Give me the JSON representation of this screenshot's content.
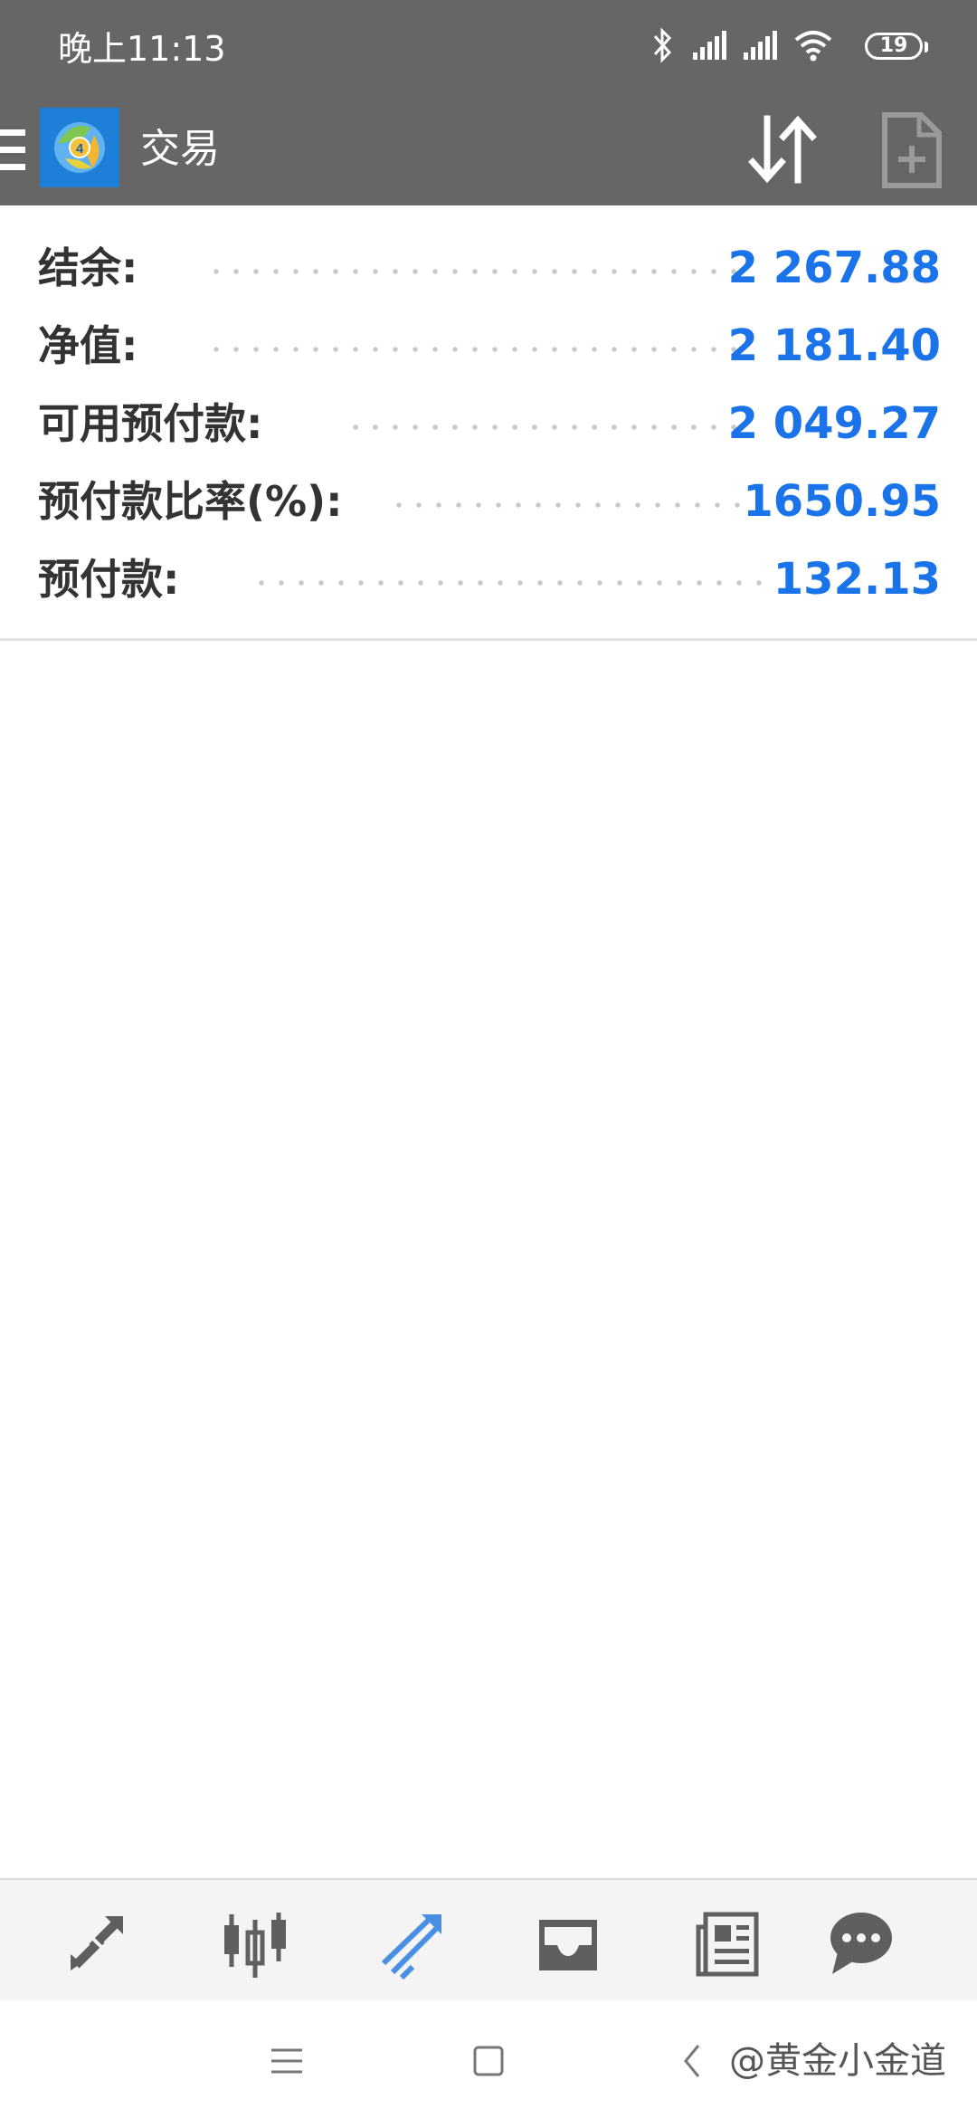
{
  "status_bar": {
    "time": "晚上11:13",
    "battery": "19",
    "icons": [
      "bluetooth-icon",
      "signal-icon",
      "signal-icon",
      "wifi-icon",
      "battery-icon"
    ]
  },
  "app_bar": {
    "title": "交易",
    "icons": [
      "menu-icon",
      "app-logo",
      "sort-icon",
      "new-order-icon"
    ]
  },
  "account": {
    "rows": [
      {
        "label": "结余:",
        "value": "2 267.88"
      },
      {
        "label": "净值:",
        "value": "2 181.40"
      },
      {
        "label": "可用预付款:",
        "value": "2 049.27"
      },
      {
        "label": "预付款比率(%):",
        "value": "1650.95"
      },
      {
        "label": "预付款:",
        "value": "132.13"
      }
    ]
  },
  "tabs": [
    {
      "icon": "quotes-icon",
      "active": false
    },
    {
      "icon": "chart-candles-icon",
      "active": false
    },
    {
      "icon": "trade-icon",
      "active": true
    },
    {
      "icon": "history-inbox-icon",
      "active": false
    },
    {
      "icon": "news-icon",
      "active": false
    },
    {
      "icon": "chat-icon",
      "active": false
    }
  ],
  "system_nav": {
    "watermark": "@黄金小金道"
  },
  "colors": {
    "header": "#666666",
    "value_blue": "#1a73e8",
    "active_tab": "#4a90e2",
    "inactive_tab": "#5f5f5f"
  }
}
